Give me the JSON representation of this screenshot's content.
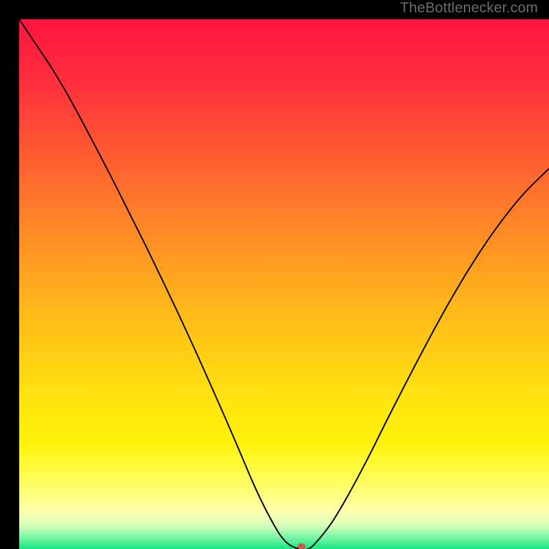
{
  "watermark": "TheBottlenecker.com",
  "chart_data": {
    "type": "line",
    "title": "",
    "xlabel": "",
    "ylabel": "",
    "xlim": [
      0,
      100
    ],
    "ylim": [
      0,
      100
    ],
    "background_gradient": {
      "type": "vertical",
      "stops": [
        {
          "offset": 0.0,
          "color": "#ff1440"
        },
        {
          "offset": 0.12,
          "color": "#ff2f3c"
        },
        {
          "offset": 0.25,
          "color": "#ff5a32"
        },
        {
          "offset": 0.4,
          "color": "#ff8a26"
        },
        {
          "offset": 0.55,
          "color": "#ffb91a"
        },
        {
          "offset": 0.7,
          "color": "#ffe010"
        },
        {
          "offset": 0.8,
          "color": "#fff30a"
        },
        {
          "offset": 0.88,
          "color": "#ffff66"
        },
        {
          "offset": 0.93,
          "color": "#fdffb0"
        },
        {
          "offset": 0.955,
          "color": "#d8ffb8"
        },
        {
          "offset": 0.975,
          "color": "#86f7a8"
        },
        {
          "offset": 1.0,
          "color": "#17e884"
        }
      ]
    },
    "series": [
      {
        "name": "bottleneck-curve",
        "color": "#000000",
        "width": 2,
        "x": [
          0,
          3,
          6,
          9,
          12,
          15,
          18,
          21,
          24,
          27,
          30,
          33,
          36,
          39,
          42,
          44,
          46,
          48,
          49.5,
          51,
          53,
          54.5,
          56,
          59,
          62,
          66,
          70,
          75,
          80,
          85,
          90,
          95,
          100
        ],
        "y": [
          100,
          95.5,
          91,
          86,
          80.5,
          74.8,
          69,
          63,
          57,
          50.8,
          44.5,
          38,
          31.3,
          24.5,
          17.5,
          12.8,
          8.5,
          4.7,
          2.3,
          0.8,
          0.0,
          0.0,
          1.2,
          5.0,
          10.0,
          17.5,
          25.5,
          35.2,
          44.5,
          53.0,
          60.5,
          66.8,
          71.8
        ]
      }
    ],
    "marker": {
      "name": "optimal-point",
      "x": 53.3,
      "y": 0.5,
      "color": "#c85a54",
      "rx": 6,
      "ry": 4.5
    }
  }
}
